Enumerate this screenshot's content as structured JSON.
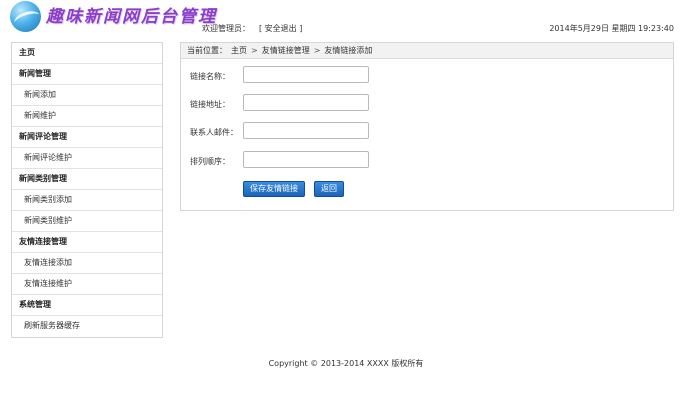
{
  "header": {
    "logo_text": "趣味新闻网后台管理",
    "welcome_text": "欢迎管理员：",
    "logout_label": "[ 安全退出 ]",
    "datetime": "2014年5月29日 星期四 19:23:40"
  },
  "sidebar": {
    "items": [
      {
        "label": "主页",
        "type": "group"
      },
      {
        "label": "新闻管理",
        "type": "group"
      },
      {
        "label": "新闻添加",
        "type": "item"
      },
      {
        "label": "新闻维护",
        "type": "item"
      },
      {
        "label": "新闻评论管理",
        "type": "group"
      },
      {
        "label": "新闻评论维护",
        "type": "item"
      },
      {
        "label": "新闻类别管理",
        "type": "group"
      },
      {
        "label": "新闻类别添加",
        "type": "item"
      },
      {
        "label": "新闻类别维护",
        "type": "item"
      },
      {
        "label": "友情连接管理",
        "type": "group"
      },
      {
        "label": "友情连接添加",
        "type": "item"
      },
      {
        "label": "友情连接维护",
        "type": "item"
      },
      {
        "label": "系统管理",
        "type": "group"
      },
      {
        "label": "刷新服务器缓存",
        "type": "item"
      }
    ]
  },
  "breadcrumb": {
    "prefix": "当前位置：",
    "items": [
      "主页",
      "友情链接管理",
      "友情链接添加"
    ],
    "separator": ">"
  },
  "form": {
    "fields": [
      {
        "label": "链接名称：",
        "value": "",
        "placeholder": ""
      },
      {
        "label": "链接地址：",
        "value": "",
        "placeholder": ""
      },
      {
        "label": "联系人邮件：",
        "value": "",
        "placeholder": ""
      },
      {
        "label": "排列顺序：",
        "value": "",
        "placeholder": ""
      }
    ],
    "save_label": "保存友情链接",
    "back_label": "返回"
  },
  "footer": {
    "copyright": "Copyright © 2013-2014 XXXX 版权所有"
  },
  "colors": {
    "accent": "#1c64bb",
    "logo_purple": "#8a3fc8",
    "border": "#d6d6d6"
  }
}
